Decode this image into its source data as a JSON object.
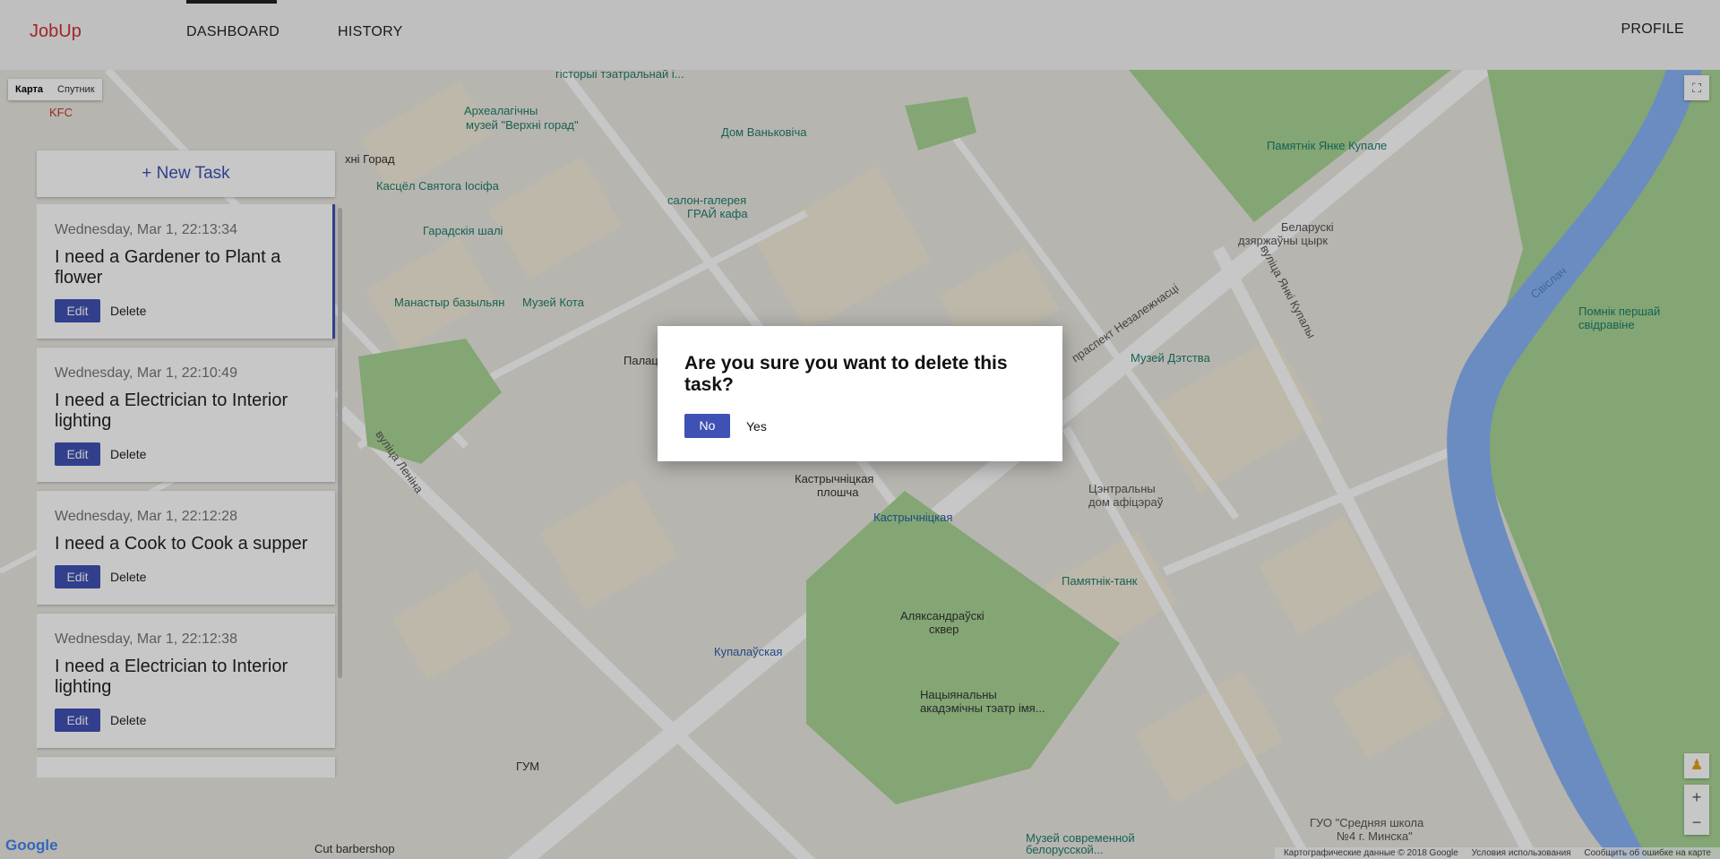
{
  "nav": {
    "brand": "JobUp",
    "links": [
      "DASHBOARD",
      "HISTORY"
    ],
    "profile": "PROFILE"
  },
  "map": {
    "type_controls": [
      "Карта",
      "Спутник"
    ],
    "logo": "Google",
    "footer": [
      "Картографические данные © 2018 Google",
      "Условия использования",
      "Сообщить об ошибке на карте"
    ],
    "labels": [
      "гісторыі тэатральнай і...",
      "Археалагічны",
      "музей \"Верхні горад\"",
      "Дом Ваньковіча",
      "Памятнік Янке Купале",
      "салон-галерея",
      "ГРАЙ кафа",
      "Беларускі",
      "дзяржаўны цырк",
      "Гарадскія шалі",
      "Касцёл Святога Іосіфа",
      "Манастыр базыльян",
      "Музей Кота",
      "Музей Дэтства",
      "Кастрычніцкая",
      "плошча",
      "Кастрычніцкая",
      "Цэнтральны",
      "дом афіцэраў",
      "Памятнік-танк",
      "Аляксандраўскі",
      "сквер",
      "Купалаўская",
      "Нацыянальны",
      "акадэмічны тэатр імя...",
      "ГУМ",
      "ГУО \"Средняя школа",
      "№4 г. Минска\"",
      "Музей современной",
      "белорусской...",
      "Cut barbershop",
      "Помнік першай",
      "свідравіне",
      "KFC",
      "праспект Незалежнасці",
      "вуліца Леніна",
      "вуліца Янкі Купалы",
      "Свіслач",
      "Палац",
      "хні Горад"
    ]
  },
  "tasks": {
    "new_task_label": "+ New Task",
    "edit_label": "Edit",
    "delete_label": "Delete",
    "items": [
      {
        "date": "Wednesday, Mar 1, 22:13:34",
        "title": "I need a Gardener to Plant a flower"
      },
      {
        "date": "Wednesday, Mar 1, 22:10:49",
        "title": "I need a Electrician to Interior lighting"
      },
      {
        "date": "Wednesday, Mar 1, 22:12:28",
        "title": "I need a Cook to Cook a supper"
      },
      {
        "date": "Wednesday, Mar 1, 22:12:38",
        "title": "I need a Electrician to Interior lighting"
      }
    ]
  },
  "dialog": {
    "title": "Are you sure you want to delete this task?",
    "no_label": "No",
    "yes_label": "Yes"
  },
  "colors": {
    "brand": "#d32f2f",
    "primary": "#3f51b5",
    "park": "#9ed28a",
    "river": "#8ab4f8"
  }
}
